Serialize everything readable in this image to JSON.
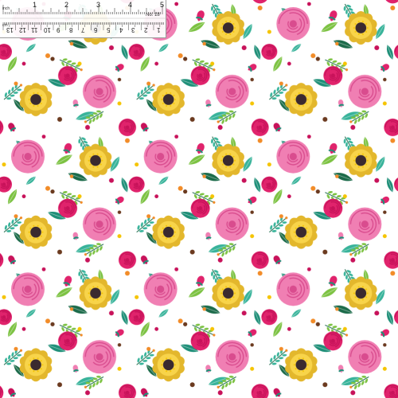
{
  "image": {
    "subject": "seamless-floral-fabric-print",
    "background_color": "#ffffff",
    "palette": {
      "pink_rose": "#f07fb3",
      "pink_rose_dark": "#d94c8e",
      "hot_pink": "#e0236c",
      "magenta": "#c8125a",
      "yellow_rose": "#f8d44a",
      "yellow_rose_dark": "#e3b72c",
      "flower_center": "#3a2a2f",
      "teal_leaf": "#1f8f78",
      "teal_leaf_light": "#38b39a",
      "green_leaf": "#7cc242",
      "dark_green": "#1c6b4a",
      "berry_orange": "#f28c28",
      "berry_brown": "#6b3a1f",
      "berry_yellow": "#f5c400"
    }
  },
  "ruler": {
    "unit_top": "inch",
    "unit_bottom": "cm",
    "swatch_number": "No. 18",
    "inch_labels": [
      "1",
      "2",
      "3",
      "4",
      "5"
    ],
    "cm_labels": [
      "13",
      "12",
      "11",
      "10",
      "9",
      "8",
      "7",
      "6",
      "5",
      "4",
      "3",
      "2",
      "1"
    ]
  }
}
